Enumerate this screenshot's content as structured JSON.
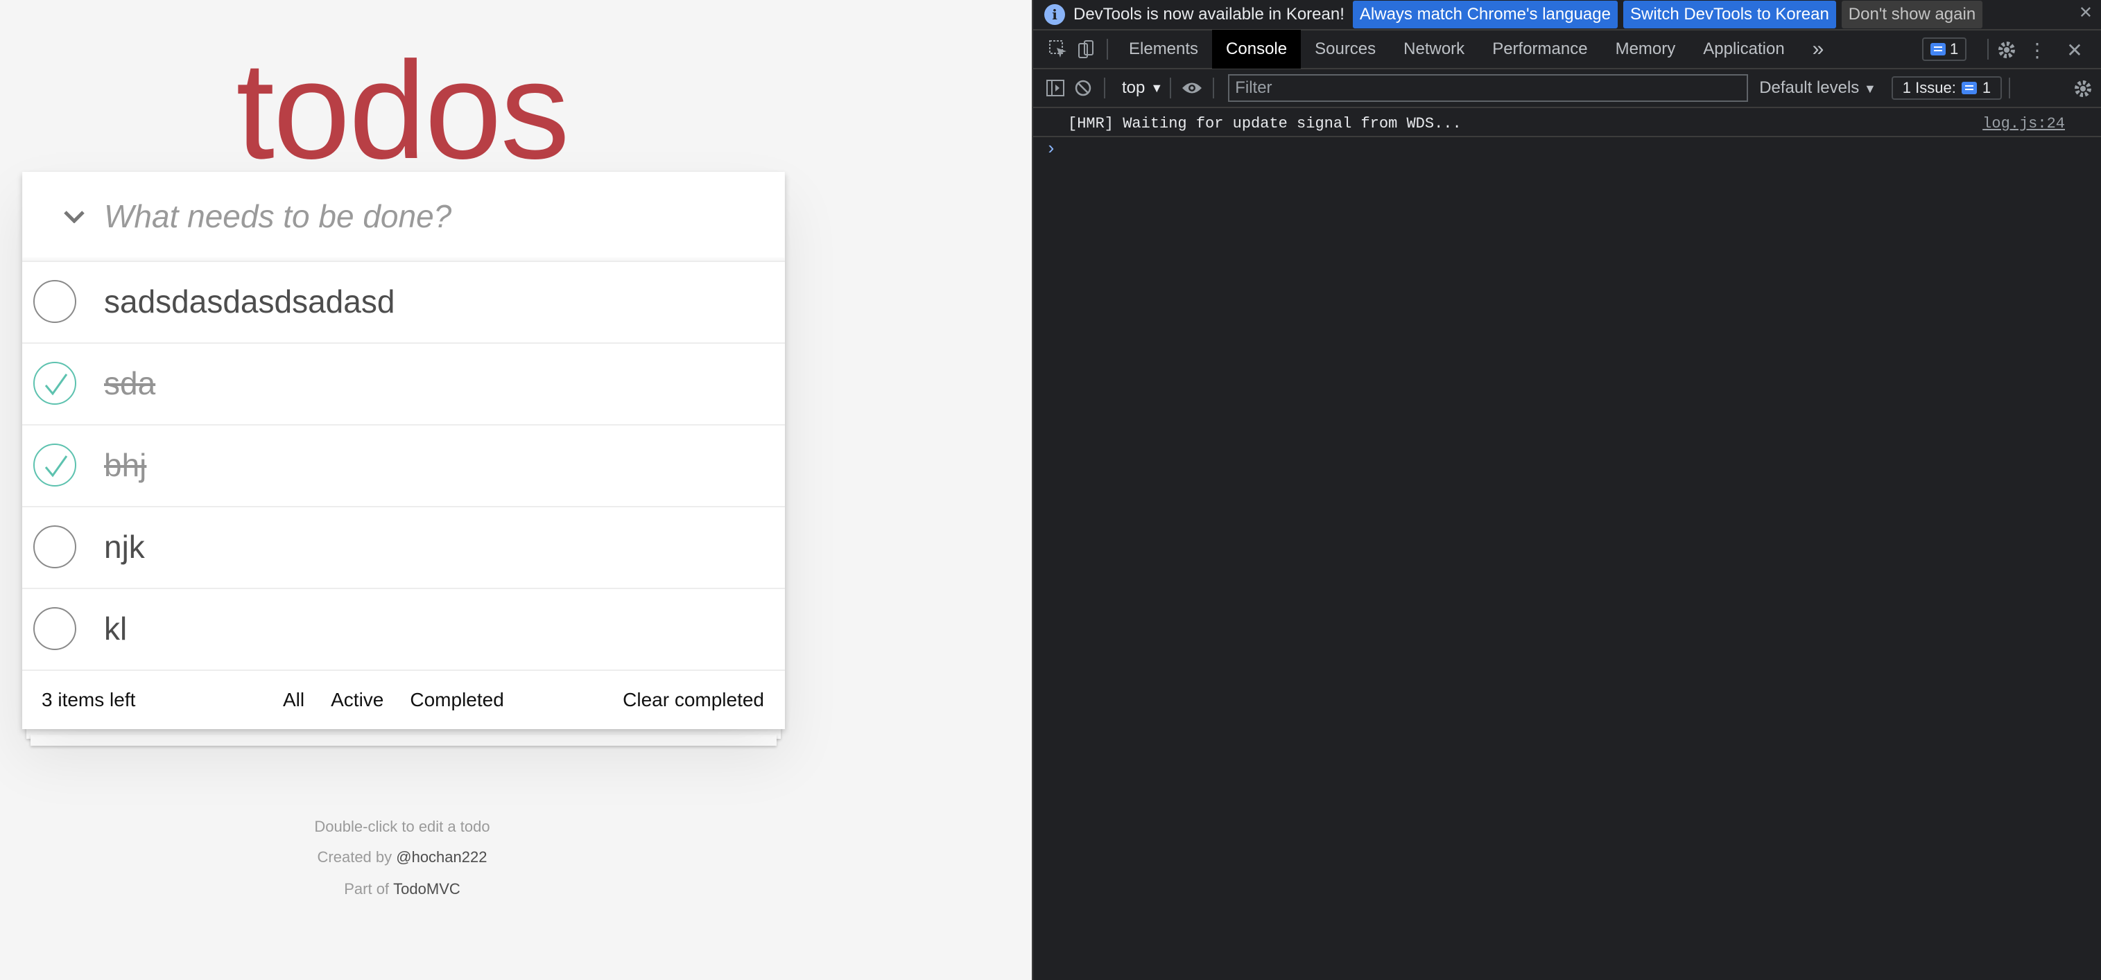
{
  "app": {
    "title": "todos",
    "new_todo_placeholder": "What needs to be done?",
    "todos": [
      {
        "label": "sadsdasdasdsadasd",
        "completed": false
      },
      {
        "label": "sda",
        "completed": true
      },
      {
        "label": "bhj",
        "completed": true
      },
      {
        "label": "njk",
        "completed": false
      },
      {
        "label": "kl",
        "completed": false
      }
    ],
    "footer": {
      "items_left": "3 items left",
      "filter_all": "All",
      "filter_active": "Active",
      "filter_completed": "Completed",
      "clear_completed": "Clear completed"
    },
    "info": {
      "hint": "Double-click to edit a todo",
      "created_by_prefix": "Created by ",
      "created_by_link": "@hochan222",
      "part_of_prefix": "Part of ",
      "part_of_link": "TodoMVC"
    },
    "colors": {
      "title": "#b83f45",
      "check": "#5dc2af"
    }
  },
  "devtools": {
    "infobar": {
      "text": "DevTools is now available in Korean!",
      "btn_match": "Always match Chrome's language",
      "btn_switch": "Switch DevTools to Korean",
      "btn_dismiss": "Don't show again"
    },
    "tabs": [
      "Elements",
      "Console",
      "Sources",
      "Network",
      "Performance",
      "Memory",
      "Application"
    ],
    "active_tab": "Console",
    "overflow": "»",
    "messages_count": "1",
    "filter": {
      "context": "top",
      "placeholder": "Filter",
      "levels": "Default levels",
      "issues_label": "1 Issue:",
      "issues_count": "1"
    },
    "console": {
      "message": "[HMR] Waiting for update signal from WDS...",
      "source": "log.js:24",
      "prompt": "›"
    }
  }
}
